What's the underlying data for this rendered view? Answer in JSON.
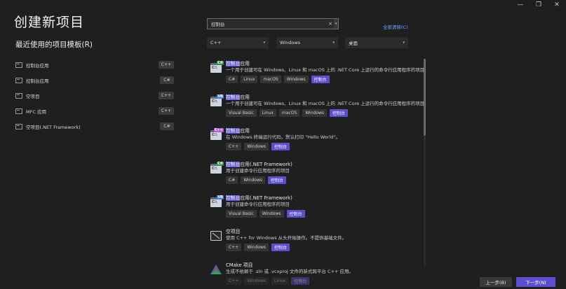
{
  "window": {
    "minimize": "—",
    "restore": "❐",
    "close": "✕"
  },
  "page": {
    "title": "创建新项目",
    "recent_title": "最近使用的项目模板(R)"
  },
  "recent": [
    {
      "label": "控制台应用",
      "badge": "C++"
    },
    {
      "label": "控制台应用",
      "badge": "C#"
    },
    {
      "label": "空项目",
      "badge": "C++"
    },
    {
      "label": "MFC 应用",
      "badge": "C++"
    },
    {
      "label": "空项目(.NET Framework)",
      "badge": "C#"
    }
  ],
  "search": {
    "value": "控制台",
    "clear_icon": "×",
    "dropdown_icon": "▾",
    "clear_all": "全部清除(C)"
  },
  "filters": {
    "language": "C++",
    "platform": "Windows",
    "project_type": "桌面"
  },
  "templates": [
    {
      "hl": "控制台",
      "rest": "应用",
      "desc": "一个用于创建可在 Windows、Linux 和 macOS 上的 .NET Core 上运行的命令行应用程序的项目",
      "tags": [
        "C#",
        "Linux",
        "macOS",
        "Windows",
        "控制台"
      ],
      "lang": "C#",
      "lang_color": "#3e8e41"
    },
    {
      "hl": "控制台",
      "rest": "应用",
      "desc": "一个用于创建可在 Windows、Linux 和 macOS 上的 .NET Core 上运行的命令行应用程序的项目",
      "tags": [
        "Visual Basic",
        "Linux",
        "macOS",
        "Windows",
        "控制台"
      ],
      "lang": "VB",
      "lang_color": "#4a7bd6"
    },
    {
      "hl": "控制台",
      "rest": "应用",
      "desc": "在 Windows 终端运行代码。默认打印 \"Hello World\"。",
      "tags": [
        "C++",
        "Windows",
        "控制台"
      ],
      "lang": "C++",
      "lang_color": "#b85bd0"
    },
    {
      "hl": "控制台",
      "rest": "应用(.NET Framework)",
      "desc": "用于创建命令行应用程序的项目",
      "tags": [
        "C#",
        "Windows",
        "控制台"
      ],
      "lang": "C#",
      "lang_color": "#3e8e41"
    },
    {
      "hl": "控制台",
      "rest": "应用(.NET Framework)",
      "desc": "用于创建命令行应用程序的项目",
      "tags": [
        "Visual Basic",
        "Windows",
        "控制台"
      ],
      "lang": "VB",
      "lang_color": "#4a7bd6"
    },
    {
      "hl": "",
      "rest": "空项目",
      "desc": "使用 C++ for Windows 从头开始操作。不提供基础文件。",
      "tags": [
        "C++",
        "Windows",
        "控制台"
      ],
      "lang": "",
      "lang_color": ""
    },
    {
      "hl": "",
      "rest": "CMake 项目",
      "desc": "生成不依赖于 .sln 或 .vcxproj 文件的新式跨平台 C++ 应用。",
      "tags": [
        "C++",
        "Windows",
        "Linux",
        "控制台"
      ],
      "lang": "",
      "lang_color": ""
    }
  ],
  "buttons": {
    "back": "上一步(B)",
    "next": "下一步(N)"
  },
  "colors": {
    "accent": "#5b4fd0",
    "link": "#6ca8ff",
    "background": "#1f1f1f"
  }
}
